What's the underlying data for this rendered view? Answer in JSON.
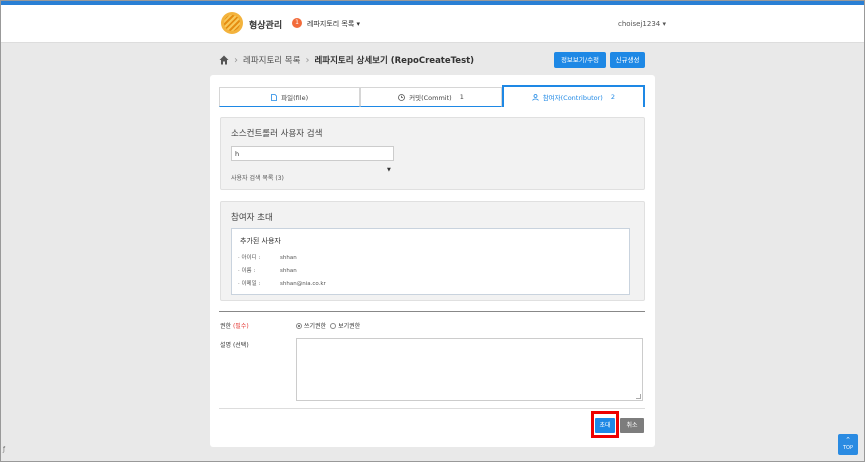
{
  "header": {
    "app_title": "형상관리",
    "badge_count": "1",
    "nav_menu": "레파지토리 목록",
    "user": "choisej1234"
  },
  "breadcrumb": {
    "items": [
      "레파지토리 목록",
      "레파지토리 상세보기 (RepoCreateTest)"
    ]
  },
  "actions": {
    "edit_label": "정보보기/수정",
    "new_label": "신규생성"
  },
  "tabs": [
    {
      "label": "파일(file)",
      "count": ""
    },
    {
      "label": "커밋(Commit)",
      "count": "1"
    },
    {
      "label": "참여자(Contributor)",
      "count": "2"
    }
  ],
  "search": {
    "title": "소스컨트롤러 사용자 검색",
    "value": "h",
    "list_label": "사용자 검색 목록 (3)"
  },
  "invite": {
    "title": "참여자 초대",
    "added_title": "추가된 사용자",
    "rows": [
      {
        "key": "· 아이디 :",
        "value": "shhan"
      },
      {
        "key": "· 이름 :",
        "value": "shhan"
      },
      {
        "key": "· 이메일 :",
        "value": "shhan@nia.co.kr"
      }
    ]
  },
  "form": {
    "permission_label": "권한",
    "required_label": "(필수)",
    "radio_options": [
      "쓰기권한",
      "보기권한"
    ],
    "description_label": "설명 (선택)"
  },
  "buttons": {
    "invite": "초대",
    "cancel": "취소",
    "top": "TOP"
  },
  "colors": {
    "accent": "#1e88e5",
    "badge": "#f26b3a",
    "highlight": "#ee0000"
  }
}
